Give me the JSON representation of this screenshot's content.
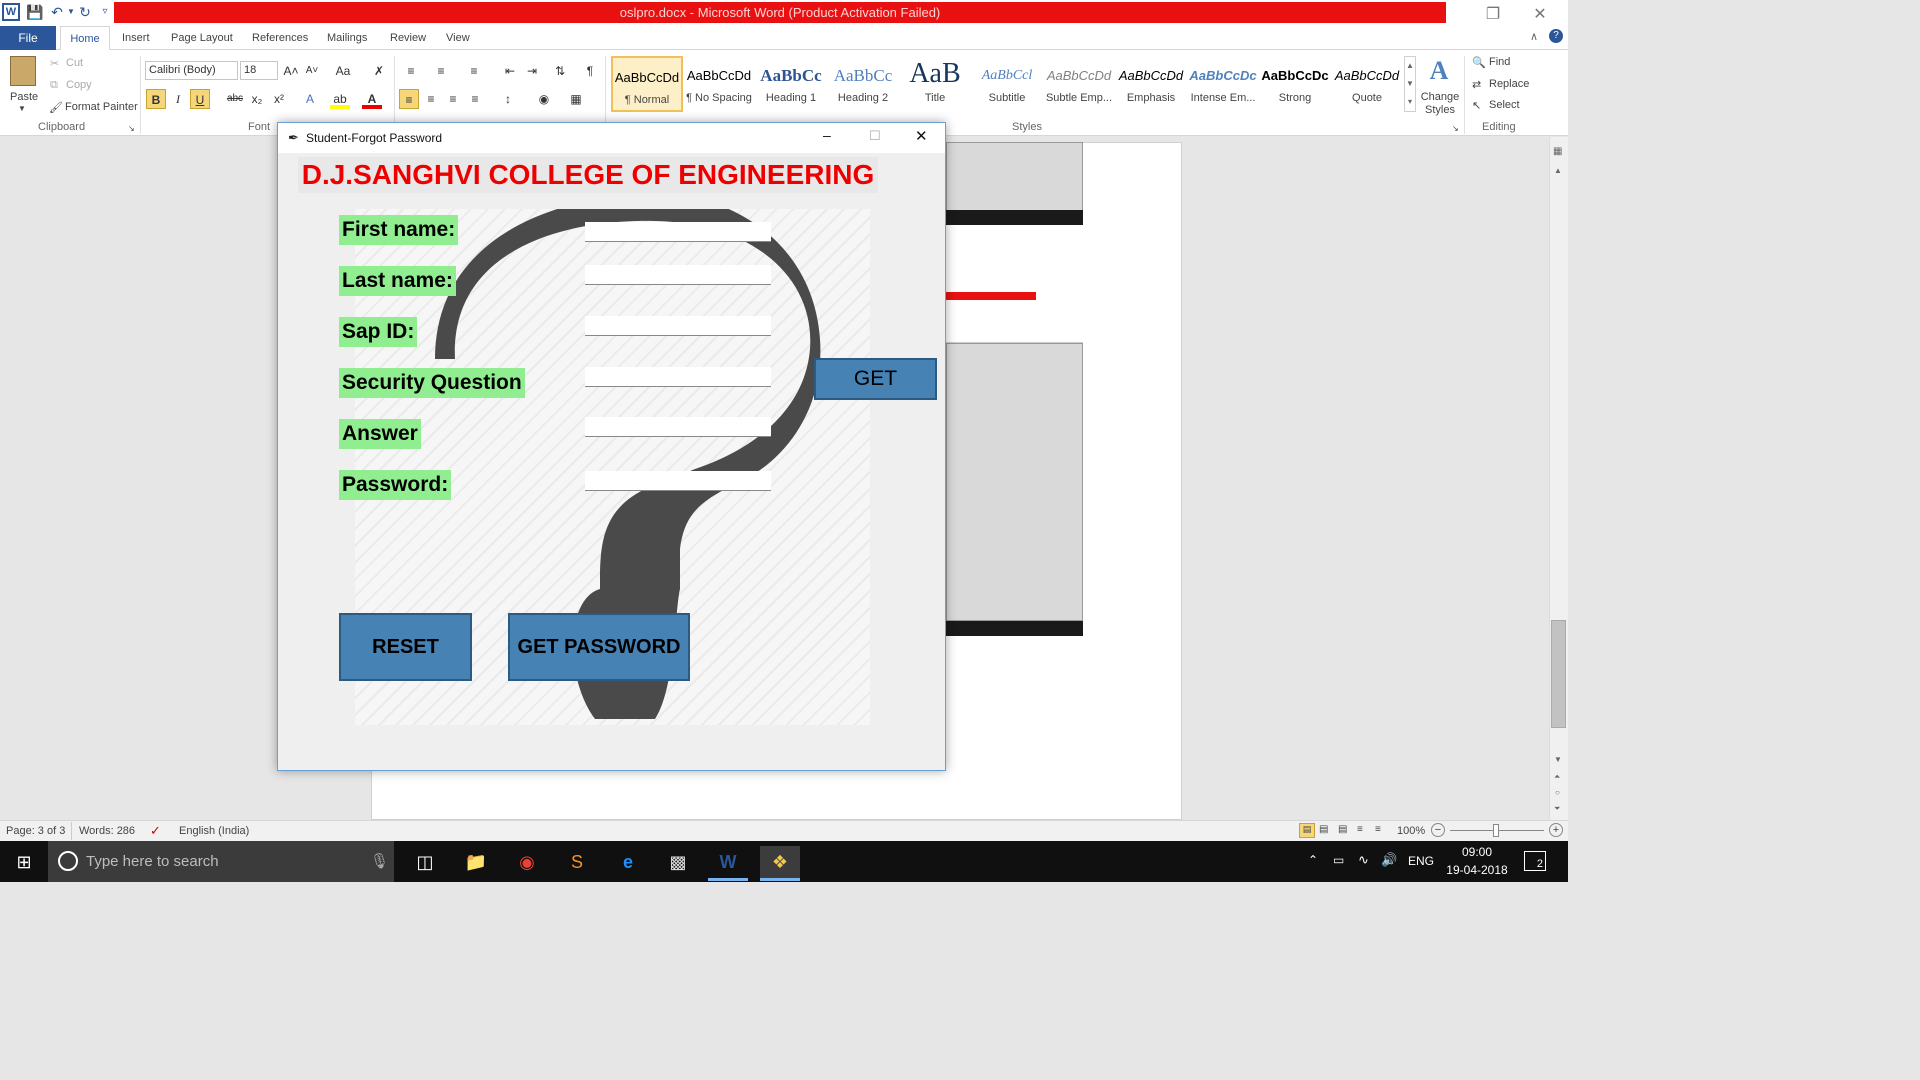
{
  "window": {
    "title": "oslpro.docx - Microsoft Word (Product Activation Failed)",
    "logo": "W"
  },
  "ribbon": {
    "file_tab": "File",
    "tabs": [
      "Home",
      "Insert",
      "Page Layout",
      "References",
      "Mailings",
      "Review",
      "View"
    ],
    "clipboard": {
      "paste": "Paste",
      "cut": "Cut",
      "copy": "Copy",
      "format_painter": "Format Painter",
      "group": "Clipboard"
    },
    "font": {
      "name": "Calibri (Body)",
      "size": "18",
      "group": "Font"
    },
    "styles": {
      "items": [
        {
          "preview": "AaBbCcDd",
          "name": "¶ Normal"
        },
        {
          "preview": "AaBbCcDd",
          "name": "¶ No Spacing"
        },
        {
          "preview": "AaBbCc",
          "name": "Heading 1"
        },
        {
          "preview": "AaBbCc",
          "name": "Heading 2"
        },
        {
          "preview": "AaB",
          "name": "Title"
        },
        {
          "preview": "AaBbCcl",
          "name": "Subtitle"
        },
        {
          "preview": "AaBbCcDd",
          "name": "Subtle Emp..."
        },
        {
          "preview": "AaBbCcDd",
          "name": "Emphasis"
        },
        {
          "preview": "AaBbCcDc",
          "name": "Intense Em..."
        },
        {
          "preview": "AaBbCcDc",
          "name": "Strong"
        },
        {
          "preview": "AaBbCcDd",
          "name": "Quote"
        }
      ],
      "change_styles": "Change Styles",
      "group": "Styles"
    },
    "editing": {
      "find": "Find",
      "replace": "Replace",
      "select": "Select",
      "group": "Editing"
    }
  },
  "dialog": {
    "title": "Student-Forgot Password",
    "college_name": "D.J.SANGHVI COLLEGE OF ENGINEERING",
    "fields": [
      {
        "label": "First name:",
        "value": ""
      },
      {
        "label": "Last name:",
        "value": ""
      },
      {
        "label": "Sap ID:",
        "value": ""
      },
      {
        "label": "Security Question",
        "value": ""
      },
      {
        "label": "Answer",
        "value": ""
      },
      {
        "label": "Password:",
        "value": ""
      }
    ],
    "get_button": "GET",
    "reset_button": "RESET",
    "get_password_button": "GET PASSWORD"
  },
  "statusbar": {
    "page": "Page: 3 of 3",
    "words": "Words: 286",
    "language": "English (India)",
    "zoom": "100%"
  },
  "taskbar": {
    "search_placeholder": "Type here to search",
    "language": "ENG",
    "time": "09:00",
    "date": "19-04-2018",
    "notifications": "2"
  },
  "colors": {
    "title_bar_red": "#e81010",
    "word_blue": "#2b579a",
    "college_red": "#ee0000",
    "label_green": "#90ee90",
    "button_blue": "#4682b4"
  }
}
